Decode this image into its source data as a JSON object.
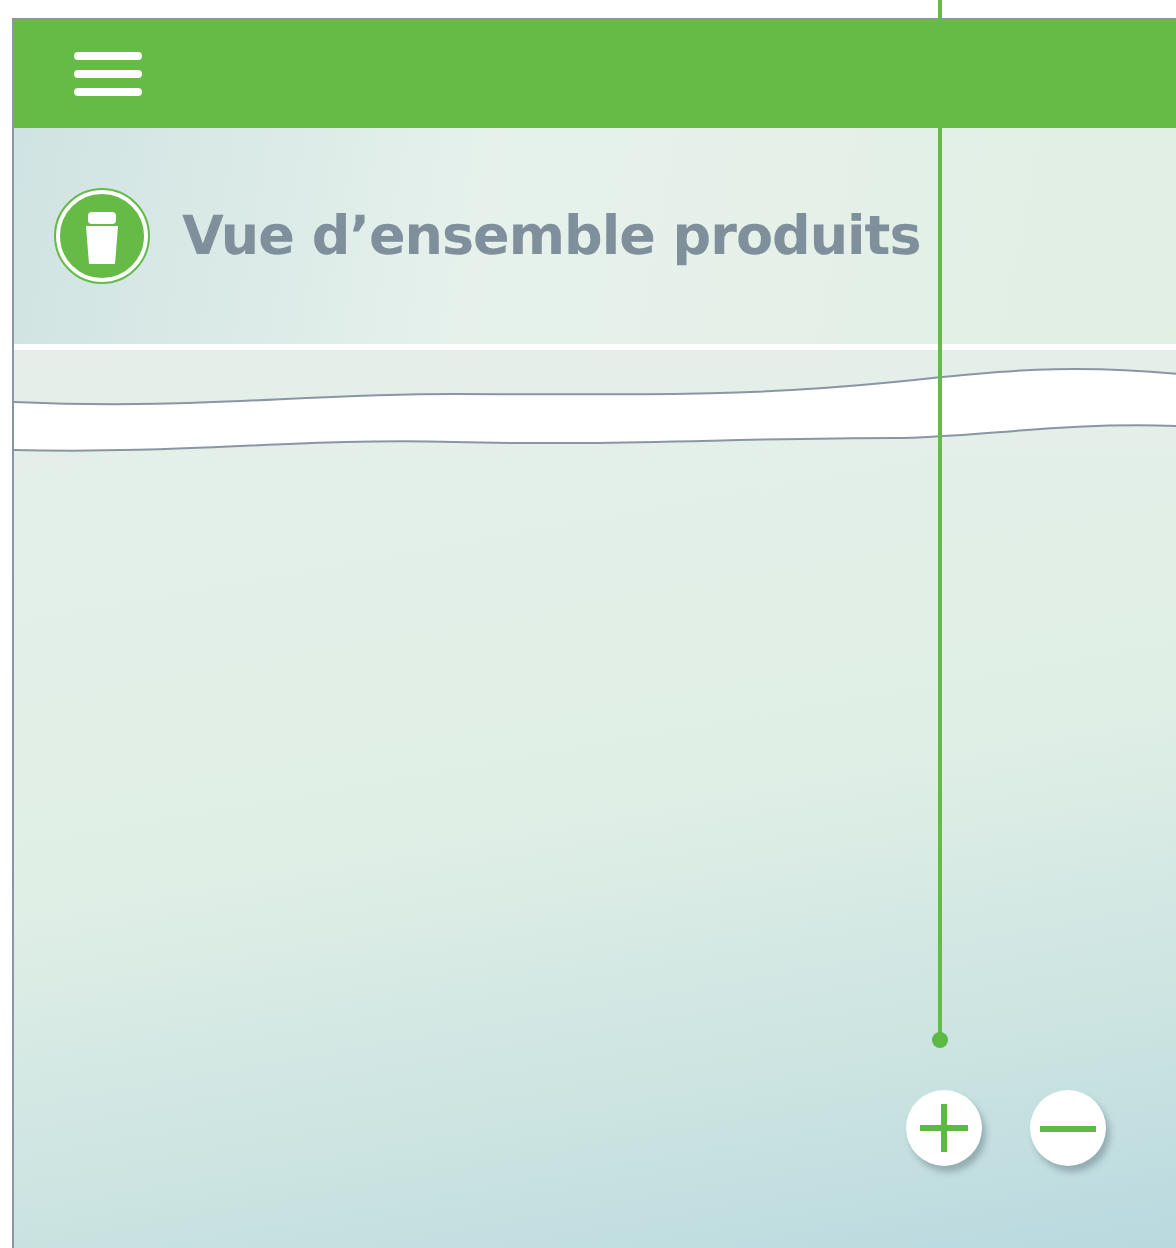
{
  "header": {
    "title": "Vue d’ensemble produits"
  }
}
